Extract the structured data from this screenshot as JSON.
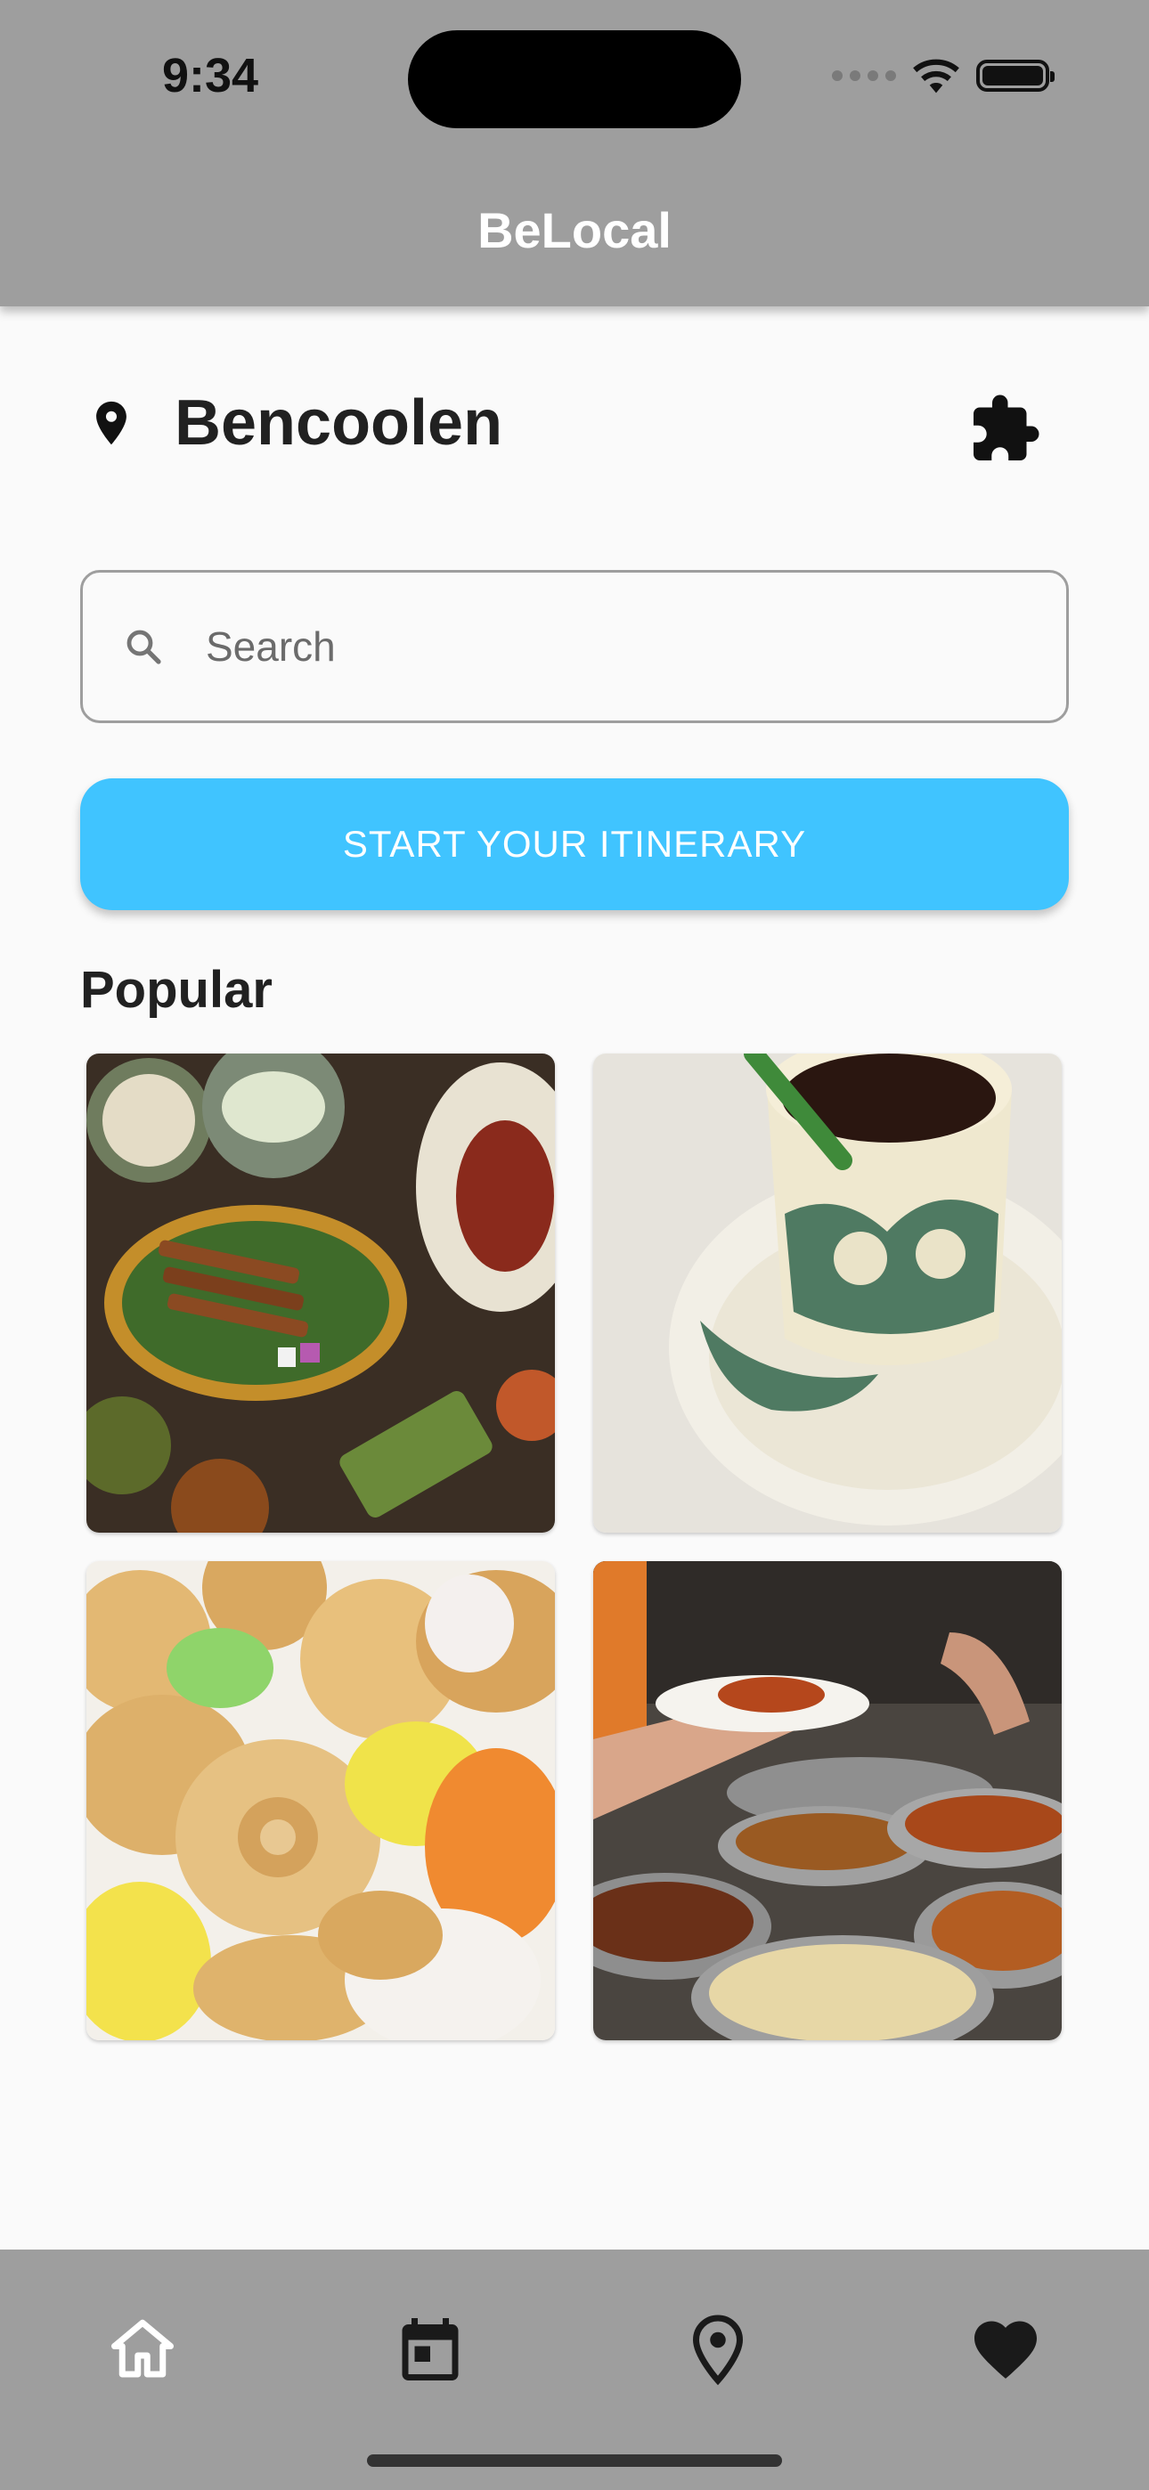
{
  "status_bar": {
    "time": "9:34"
  },
  "app_bar": {
    "title": "BeLocal"
  },
  "location": {
    "name": "Bencoolen",
    "pin_icon": "location-pin-icon",
    "action_icon": "puzzle-icon"
  },
  "search": {
    "placeholder": "Search",
    "value": "",
    "icon": "search-icon"
  },
  "cta": {
    "label": "START YOUR ITINERARY",
    "color": "#40c4ff"
  },
  "popular": {
    "title": "Popular",
    "items": [
      {
        "alt": "Malay food spread with satay"
      },
      {
        "alt": "Kopi in floral cup"
      },
      {
        "alt": "Colourful kueh biscuits"
      },
      {
        "alt": "Nasi padang serving trays"
      }
    ]
  },
  "bottom_nav": {
    "items": [
      {
        "icon": "home-icon"
      },
      {
        "icon": "calendar-icon"
      },
      {
        "icon": "location-outline-icon"
      },
      {
        "icon": "heart-icon"
      }
    ]
  },
  "colors": {
    "app_bar": "#9e9e9e",
    "accent": "#40c4ff",
    "background": "#fafafa"
  }
}
